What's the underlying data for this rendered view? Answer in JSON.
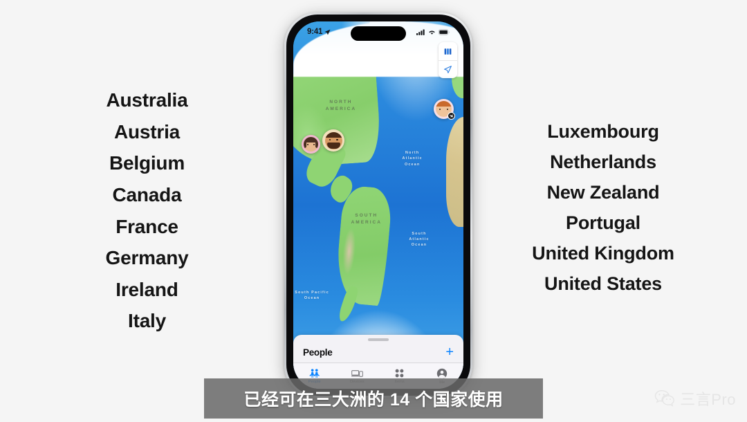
{
  "background_color": "#f5f5f5",
  "countries_left": [
    {
      "name": "Australia"
    },
    {
      "name": "Austria"
    },
    {
      "name": "Belgium"
    },
    {
      "name": "Canada"
    },
    {
      "name": "France"
    },
    {
      "name": "Germany"
    },
    {
      "name": "Ireland"
    },
    {
      "name": "Italy"
    }
  ],
  "countries_right": [
    {
      "name": "Luxembourg"
    },
    {
      "name": "Netherlands"
    },
    {
      "name": "New Zealand"
    },
    {
      "name": "Portugal"
    },
    {
      "name": "United Kingdom"
    },
    {
      "name": "United States"
    }
  ],
  "phone": {
    "status_bar": {
      "time": "9:41",
      "location_icon": "location-arrow-icon",
      "cellular_icon": "cellular-bars-icon",
      "wifi_icon": "wifi-icon",
      "battery_icon": "battery-icon"
    },
    "map": {
      "labels": [
        {
          "text": "NORTH\nAMERICA",
          "id": "north-america"
        },
        {
          "text": "SOUTH\nAMERICA",
          "id": "south-america"
        },
        {
          "text": "North\nAtlantic\nOcean",
          "id": "north-atlantic-ocean"
        },
        {
          "text": "South\nAtlantic\nOcean",
          "id": "south-atlantic-ocean"
        },
        {
          "text": "South Pacific\nOcean",
          "id": "south-pacific-ocean"
        }
      ],
      "controls": [
        {
          "id": "map-layers-button",
          "icon": "map-layers-icon"
        },
        {
          "id": "locate-me-button",
          "icon": "location-arrow-icon"
        }
      ],
      "pins": [
        {
          "id": "pin-person-1",
          "ring_color": "#f0b9cf",
          "skin": "#e8b98f",
          "hair": "#4a2f22",
          "badge": false
        },
        {
          "id": "pin-person-2",
          "ring_color": "#f3e0bd",
          "skin": "#d89a63",
          "hair": "#4b2a17",
          "badge": false
        },
        {
          "id": "pin-person-3",
          "ring_color": "#f6dfe6",
          "skin": "#f0c49a",
          "hair": "#c96a2c",
          "badge": true
        }
      ]
    },
    "sheet": {
      "title": "People",
      "add_label": "+"
    },
    "tabs": [
      {
        "label": "People",
        "icon": "people-icon",
        "active": true
      },
      {
        "label": "Devices",
        "icon": "devices-icon",
        "active": false
      },
      {
        "label": "Items",
        "icon": "items-grid-icon",
        "active": false
      },
      {
        "label": "Me",
        "icon": "person-circle-icon",
        "active": false
      }
    ]
  },
  "subtitle": {
    "text": "已经可在三大洲的 14 个国家使用"
  },
  "watermark": {
    "icon": "wechat-icon",
    "text": "三言Pro"
  },
  "accent_color": "#0b84ff"
}
